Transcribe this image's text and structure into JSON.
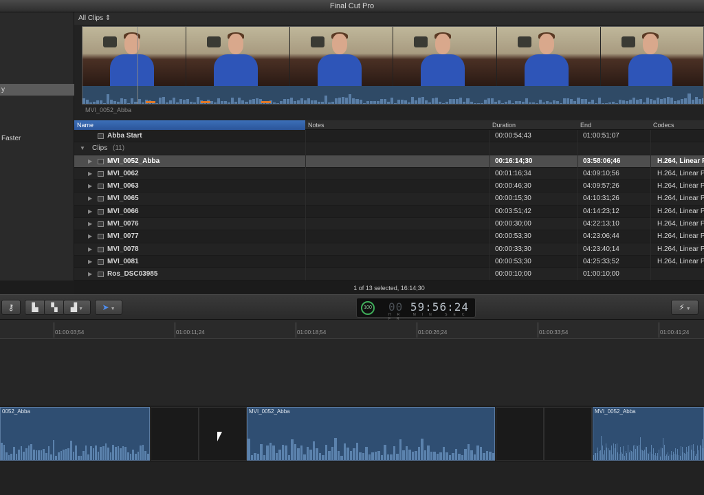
{
  "window": {
    "title": "Final Cut Pro"
  },
  "library": {
    "items": [
      {
        "label": "y",
        "selected": true
      },
      {
        "label": "Faster",
        "selected": false
      }
    ]
  },
  "browser": {
    "filter_label": "All Clips ⇕",
    "filmstrip_caption": "MVI_0052_Abba",
    "columns": {
      "name": "Name",
      "notes": "Notes",
      "duration": "Duration",
      "end": "End",
      "codecs": "Codecs"
    },
    "rows": [
      {
        "type": "event",
        "name": "Abba Start",
        "duration": "00:00:54;43",
        "end": "01:00:51;07",
        "codec": ""
      },
      {
        "type": "group",
        "name": "Clips",
        "count": "(11)"
      },
      {
        "type": "clip",
        "name": "MVI_0052_Abba",
        "duration": "00:16:14;30",
        "end": "03:58:06;46",
        "codec": "H.264, Linear P",
        "selected": true
      },
      {
        "type": "clip",
        "name": "MVI_0062",
        "duration": "00:01:16;34",
        "end": "04:09:10;56",
        "codec": "H.264, Linear P"
      },
      {
        "type": "clip",
        "name": "MVI_0063",
        "duration": "00:00:46;30",
        "end": "04:09:57;26",
        "codec": "H.264, Linear P"
      },
      {
        "type": "clip",
        "name": "MVI_0065",
        "duration": "00:00:15;30",
        "end": "04:10:31;26",
        "codec": "H.264, Linear P"
      },
      {
        "type": "clip",
        "name": "MVI_0066",
        "duration": "00:03:51;42",
        "end": "04:14:23;12",
        "codec": "H.264, Linear P"
      },
      {
        "type": "clip",
        "name": "MVI_0076",
        "duration": "00:00:30;00",
        "end": "04:22:13;10",
        "codec": "H.264, Linear P"
      },
      {
        "type": "clip",
        "name": "MVI_0077",
        "duration": "00:00:53;30",
        "end": "04:23:06;44",
        "codec": "H.264, Linear P"
      },
      {
        "type": "clip",
        "name": "MVI_0078",
        "duration": "00:00:33;30",
        "end": "04:23:40;14",
        "codec": "H.264, Linear P"
      },
      {
        "type": "clip",
        "name": "MVI_0081",
        "duration": "00:00:53;30",
        "end": "04:25:33;52",
        "codec": "H.264, Linear P"
      },
      {
        "type": "clip",
        "name": "Ros_DSC03985",
        "duration": "00:00:10;00",
        "end": "01:00:10;00",
        "codec": ""
      }
    ],
    "status": "1 of 13 selected, 16:14;30"
  },
  "toolbar": {
    "timecode": {
      "ring_value": "100",
      "dim_prefix": "00",
      "value": "59:56:24",
      "labels": "HR MIN SEC FR"
    }
  },
  "ruler": {
    "ticks": [
      "01:00:03;54",
      "01:00:11;24",
      "01:00:18;54",
      "01:00:26;24",
      "01:00:33;54",
      "01:00:41;24"
    ]
  },
  "timeline": {
    "clips": [
      {
        "label": "0052_Abba"
      },
      {
        "label": "MVI_0052_Abba"
      },
      {
        "label": "MVI_0052_Abba"
      }
    ]
  },
  "colors": {
    "selection_blue": "#2b559a",
    "audio_blue": "#2f4e72",
    "timecode_green": "#3fae5a",
    "marker_orange": "#e07a2a"
  },
  "icons": [
    "key-icon",
    "connect-clip-icon",
    "insert-clip-icon",
    "append-clip-icon",
    "arrow-tool-icon",
    "magic-wand-icon",
    "disclosure-triangle-icon",
    "clip-icon"
  ]
}
